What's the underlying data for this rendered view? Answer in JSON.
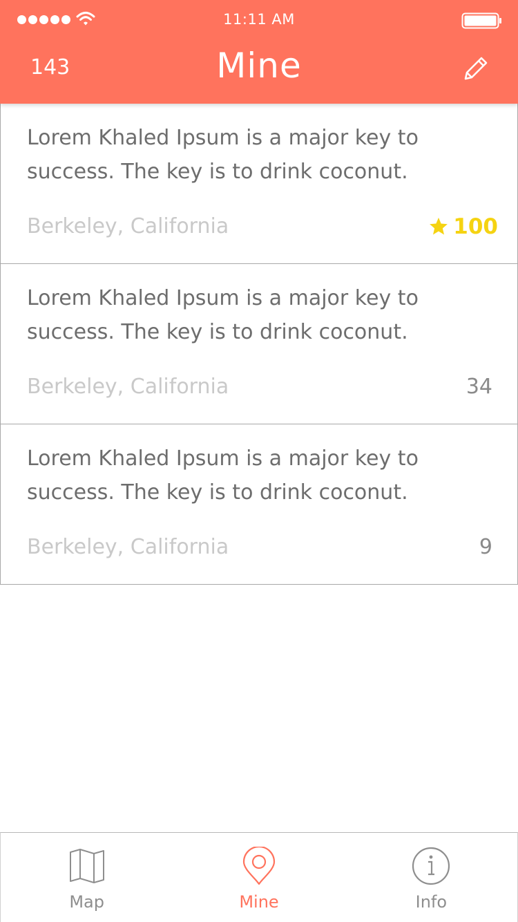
{
  "status_bar": {
    "time": "11:11 AM",
    "signal_icon": "signal-dots-icon",
    "wifi_icon": "wifi-icon",
    "battery_icon": "battery-icon"
  },
  "header": {
    "count": "143",
    "title": "Mine",
    "edit_icon": "pencil-icon",
    "background_color": "#FF735D"
  },
  "posts": [
    {
      "text": "Lorem Khaled Ipsum is a major key to success. The key is to drink coconut.",
      "location": "Berkeley, California",
      "score": "100",
      "top": true,
      "score_color": "#F5D312"
    },
    {
      "text": "Lorem Khaled Ipsum is a major key to success. The key is to drink coconut.",
      "location": "Berkeley, California",
      "score": "34",
      "top": false
    },
    {
      "text": "Lorem Khaled Ipsum is a major key to success. The key is to drink coconut.",
      "location": "Berkeley, California",
      "score": "9",
      "top": false
    }
  ],
  "tabs": [
    {
      "label": "Map",
      "icon": "map-icon",
      "active": false
    },
    {
      "label": "Mine",
      "icon": "location-pin-icon",
      "active": true
    },
    {
      "label": "Info",
      "icon": "info-icon",
      "active": false
    }
  ],
  "colors": {
    "accent": "#FF735D",
    "text": "#6d6d6d",
    "muted": "#c9c9c9",
    "star": "#F5D312"
  }
}
